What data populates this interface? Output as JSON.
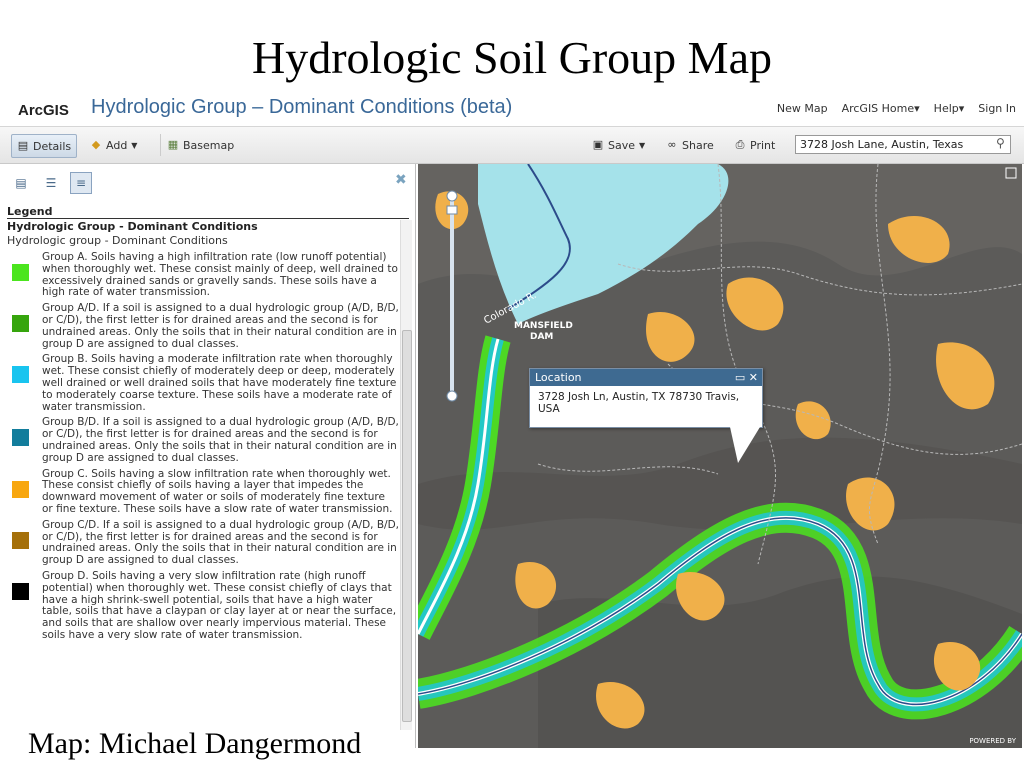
{
  "slide": {
    "title": "Hydrologic Soil Group Map",
    "caption": "Map: Michael Dangermond"
  },
  "header": {
    "logo": "ArcGIS",
    "title": "Hydrologic Group – Dominant Conditions (beta)",
    "nav": [
      "New Map",
      "ArcGIS Home▾",
      "Help▾",
      "Sign In"
    ]
  },
  "toolbar": {
    "details": "Details",
    "add": "Add",
    "basemap": "Basemap",
    "save": "Save",
    "share": "Share",
    "print": "Print",
    "search_value": "3728 Josh Lane, Austin, Texas"
  },
  "panel": {
    "legend_title": "Legend",
    "layer_name": "Hydrologic Group - Dominant Conditions",
    "layer_sub": "Hydrologic group - Dominant Conditions",
    "items": [
      {
        "color": "#4be51e",
        "text": "Group A. Soils having a high infiltration rate (low runoff potential) when thoroughly wet. These consist mainly of deep, well drained to excessively drained sands or gravelly sands. These soils have a high rate of water transmission."
      },
      {
        "color": "#36a50d",
        "text": "Group A/D. If a soil is assigned to a dual hydrologic group (A/D, B/D, or C/D), the first letter is for drained areas and the second is for undrained areas. Only the soils that in their natural condition are in group D are assigned to dual classes."
      },
      {
        "color": "#19c4ef",
        "text": "Group B. Soils having a moderate infiltration rate when thoroughly wet. These consist chiefly of moderately deep or deep, moderately well drained or well drained soils that have moderately fine texture to moderately coarse texture. These soils have a moderate rate of water transmission."
      },
      {
        "color": "#127d9c",
        "text": "Group B/D. If a soil is assigned to a dual hydrologic group (A/D, B/D, or C/D), the first letter is for drained areas and the second is for undrained areas. Only the soils that in their natural condition are in group D are assigned to dual classes."
      },
      {
        "color": "#f8a70f",
        "text": "Group C. Soils having a slow infiltration rate when thoroughly wet. These consist chiefly of soils having a layer that impedes the downward movement of water or soils of moderately fine texture or fine texture. These soils have a slow rate of water transmission."
      },
      {
        "color": "#a5700a",
        "text": "Group C/D. If a soil is assigned to a dual hydrologic group (A/D, B/D, or C/D), the first letter is for drained areas and the second is for undrained areas. Only the soils that in their natural condition are in group D are assigned to dual classes."
      },
      {
        "color": "#000000",
        "text": "Group D. Soils having a very slow infiltration rate (high runoff potential) when thoroughly wet. These consist chiefly of clays that have a high shrink-swell potential, soils that have a high water table, soils that have a claypan or clay layer at or near the surface, and soils that are shallow over nearly impervious material. These soils have a very slow rate of water transmission."
      }
    ]
  },
  "map": {
    "labels": {
      "river": "Colorado R.",
      "dam1": "MANSFIELD",
      "dam2": "DAM"
    },
    "popup": {
      "title": "Location",
      "body": "3728 Josh Ln, Austin, TX 78730 Travis, USA"
    },
    "powered": "POWERED BY"
  }
}
